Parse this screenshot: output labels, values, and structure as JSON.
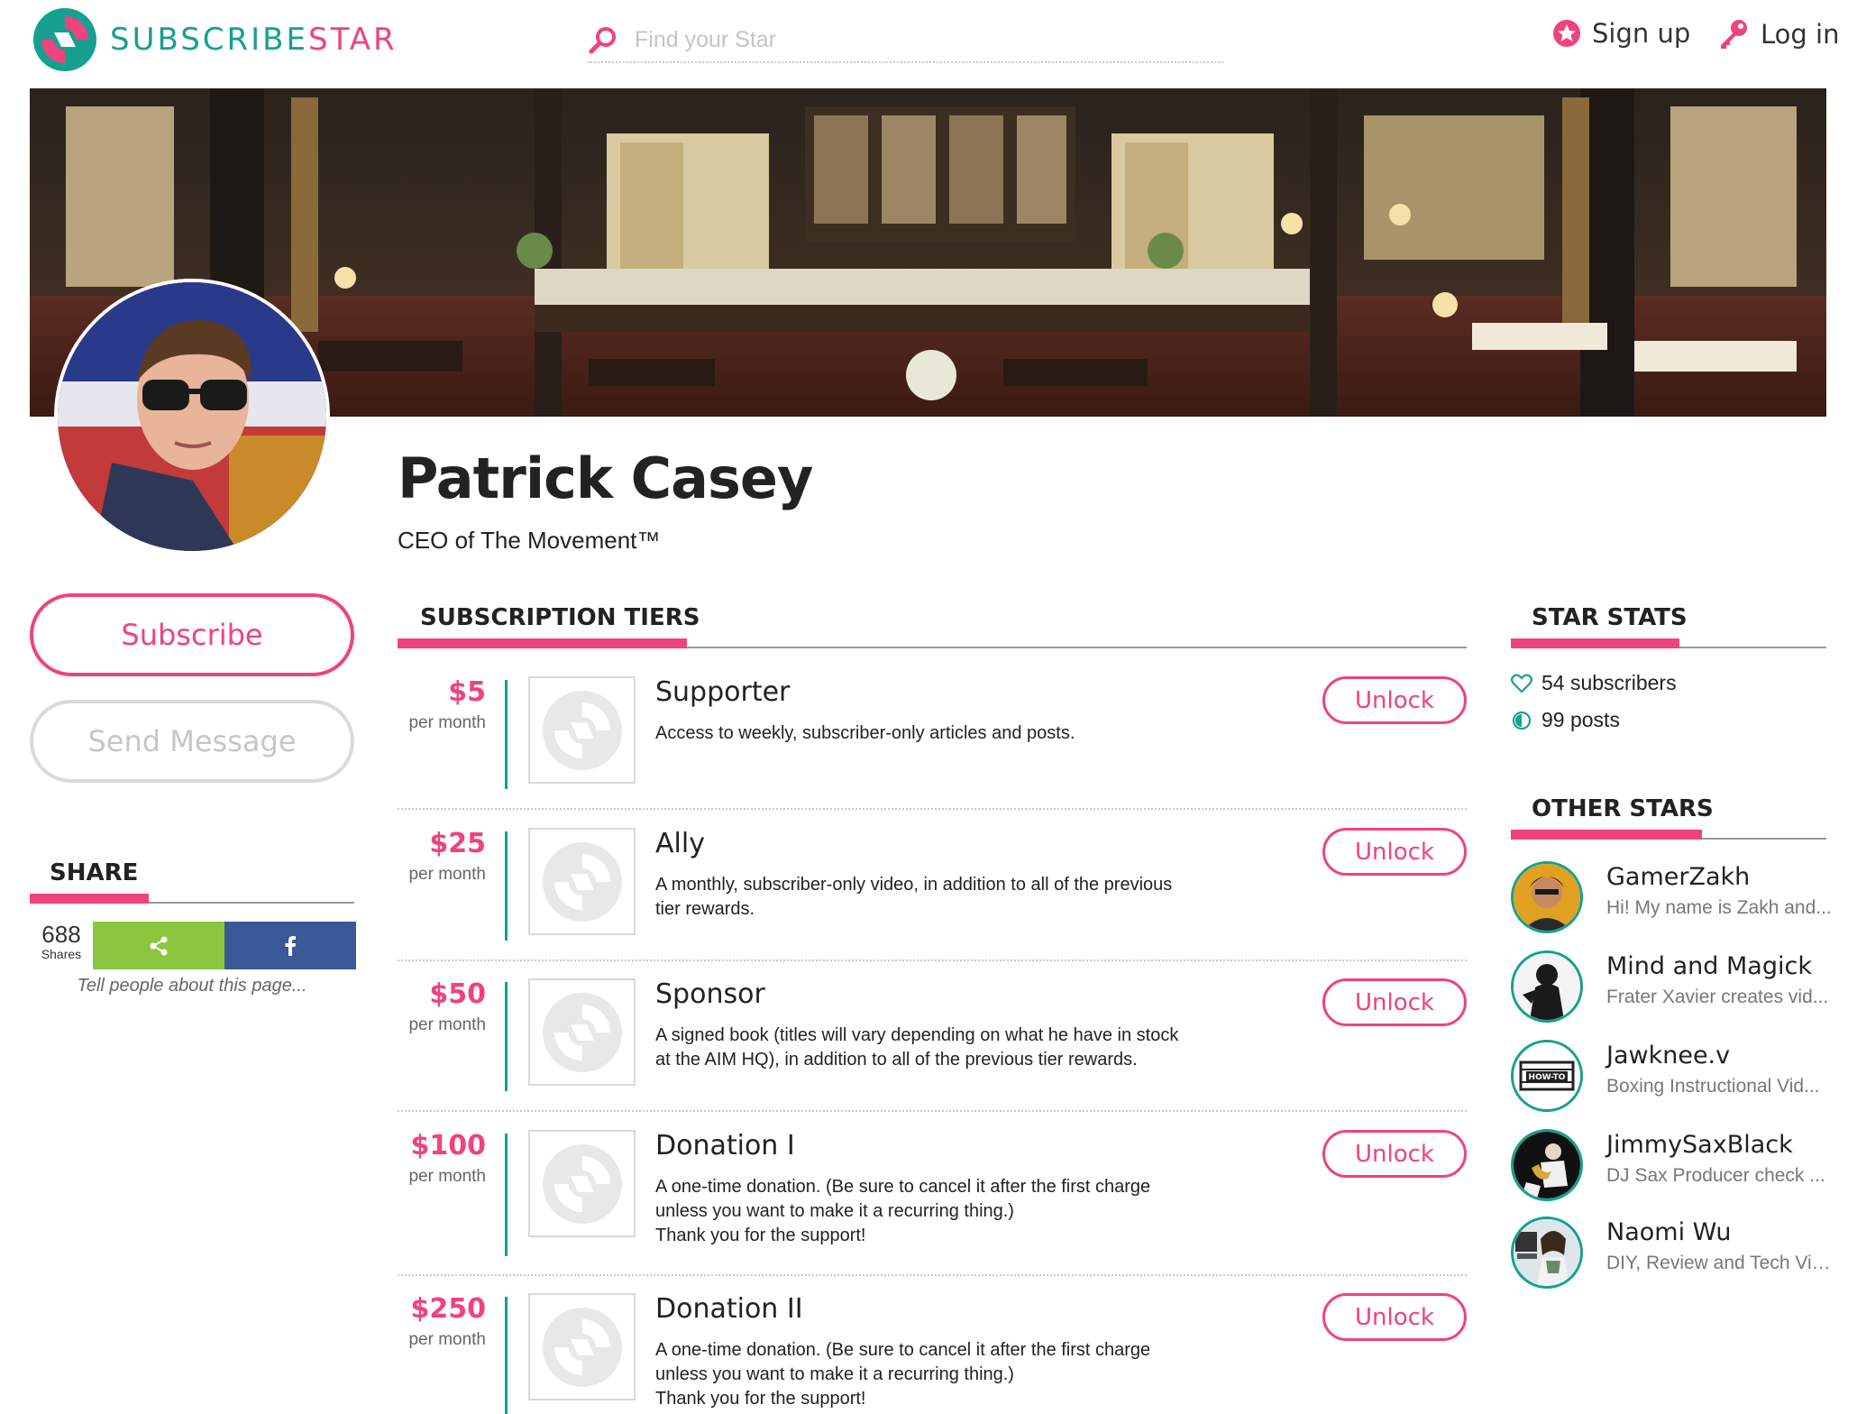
{
  "brand": {
    "logo_part1": "SUBSCRIBE",
    "logo_part2": "STAR"
  },
  "search": {
    "placeholder": "Find your Star"
  },
  "nav": {
    "signup_label": "Sign up",
    "login_label": "Log in"
  },
  "profile": {
    "name": "Patrick Casey",
    "tagline": "CEO of The Movement™"
  },
  "actions": {
    "subscribe_label": "Subscribe",
    "message_label": "Send Message"
  },
  "share": {
    "heading": "SHARE",
    "count": "688",
    "count_label": "Shares",
    "tell": "Tell people about this page..."
  },
  "tiers_heading": "SUBSCRIPTION TIERS",
  "tiers": [
    {
      "price": "$5",
      "per": "per month",
      "title": "Supporter",
      "description": "Access to weekly, subscriber-only articles and posts.",
      "button": "Unlock"
    },
    {
      "price": "$25",
      "per": "per month",
      "title": "Ally",
      "description": "A monthly, subscriber-only video, in addition to all of the previous\ntier rewards.",
      "button": "Unlock"
    },
    {
      "price": "$50",
      "per": "per month",
      "title": "Sponsor",
      "description": "A signed book (titles will vary depending on what he have in stock\nat the AIM HQ), in addition to all of the previous tier rewards.",
      "button": "Unlock"
    },
    {
      "price": "$100",
      "per": "per month",
      "title": "Donation I",
      "description": "A one-time donation. (Be sure to cancel it after the first charge\nunless you want to make it a recurring thing.)\nThank you for the support!",
      "button": "Unlock"
    },
    {
      "price": "$250",
      "per": "per month",
      "title": "Donation II",
      "description": "A one-time donation. (Be sure to cancel it after the first charge\nunless you want to make it a recurring thing.)\nThank you for the support!",
      "button": "Unlock"
    }
  ],
  "stats": {
    "heading": "STAR STATS",
    "subscribers": "54 subscribers",
    "posts": "99 posts"
  },
  "other_stars": {
    "heading": "OTHER STARS",
    "items": [
      {
        "name": "GamerZakh",
        "desc": "Hi! My name is Zakh and..."
      },
      {
        "name": "Mind and Magick",
        "desc": "Frater Xavier creates vid..."
      },
      {
        "name": "Jawknee.v",
        "desc": "Boxing Instructional Vid..."
      },
      {
        "name": "JimmySaxBlack",
        "desc": "DJ Sax Producer check ..."
      },
      {
        "name": "Naomi Wu",
        "desc": "DIY, Review and Tech Vid..."
      }
    ]
  },
  "colors": {
    "brand_pink": "#f0427e",
    "brand_teal": "#16a08f",
    "share_green": "#8cc63f",
    "facebook_blue": "#3b5998"
  }
}
